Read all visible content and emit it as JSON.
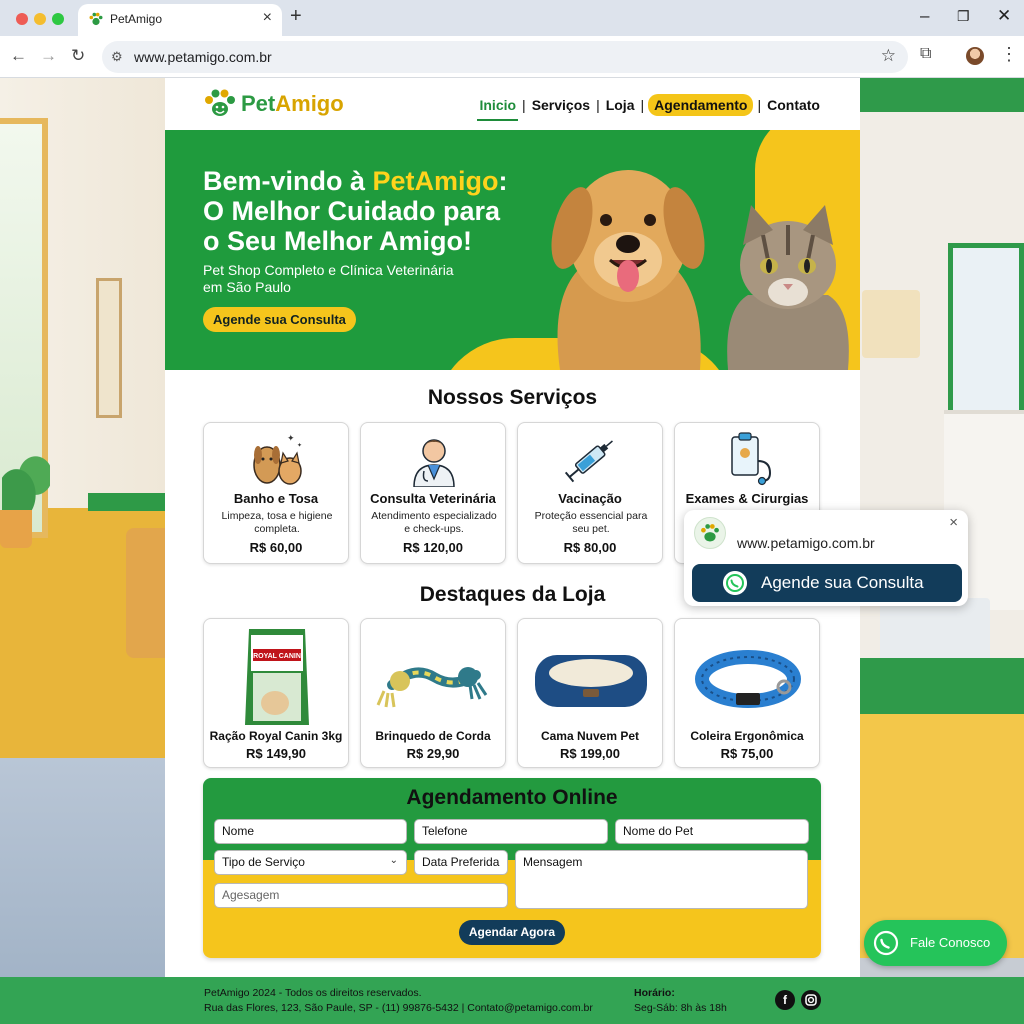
{
  "browser": {
    "tab_title": "PetAmigo",
    "url": "www.petamigo.com.br"
  },
  "site": {
    "logo": {
      "pet": "Pet",
      "amigo": "Amigo"
    },
    "nav": [
      "Inicio",
      "Serviços",
      "Loja",
      "Agendamento",
      "Contato"
    ],
    "nav_separator": "|",
    "hero": {
      "title_line1_prefix": "Bem-vindo à ",
      "title_line1_brand": "PetAmigo",
      "title_line1_suffix": ":",
      "title_line2": "O Melhor Cuidado para",
      "title_line3": "o Seu  Melhor Amigo!",
      "subtitle_line1": "Pet Shop Completo e Clínica Veterinária",
      "subtitle_line2": "em São Paulo",
      "cta": "Agende sua Consulta"
    },
    "services_title": "Nossos Serviços",
    "services": [
      {
        "name": "Banho e Tosa",
        "desc_line1": "Limpeza, tosa e higiene",
        "desc_line2": "completa.",
        "price": "R$ 60,00",
        "icon": "dog-cat-icon"
      },
      {
        "name": "Consulta Veterinária",
        "desc_line1": "Atendimento especializado",
        "desc_line2": "e check-ups.",
        "price": "R$ 120,00",
        "icon": "veterinarian-icon"
      },
      {
        "name": "Vacinação",
        "desc_line1": "Proteção essencial para",
        "desc_line2": "seu pet.",
        "price": "R$ 80,00",
        "icon": "syringe-icon"
      },
      {
        "name": "Exames & Cirurgias",
        "desc_line1": "",
        "desc_line2": "",
        "price": "",
        "icon": "clipboard-stethoscope-icon"
      }
    ],
    "shop_title": "Destaques da Loja",
    "products": [
      {
        "name": "Ração Royal Canin 3kg",
        "price": "R$ 149,90",
        "image_text": "ROYAL CANIN"
      },
      {
        "name": "Brinquedo de Corda",
        "price": "R$ 29,90"
      },
      {
        "name": "Cama Nuvem Pet",
        "price": "R$ 199,00"
      },
      {
        "name": "Coleira Ergonômica",
        "price": "R$ 75,00"
      }
    ],
    "booking": {
      "title": "Agendamento Online",
      "name": "Nome",
      "phone": "Telefone",
      "pet_name": "Nome do Pet",
      "service_type": "Tipo de Serviço",
      "date": "Data Preferida",
      "message": "Mensagem",
      "extra_placeholder": "Agesagem",
      "submit": "Agendar Agora"
    },
    "footer": {
      "line1": "PetAmigo 2024 - Todos os direitos reservados.",
      "line2": "Rua das Flores, 123, São Paule, SP - (11) 99876-5432 | Contato@petamigo.com.br",
      "hours_label": "Horário:",
      "hours_value": "Seg-Sáb: 8h às 18h",
      "facebook": "f"
    }
  },
  "popup": {
    "url": "www.petamigo.com.br",
    "button": "Agende sua Consulta"
  },
  "whatsapp_float": {
    "label": "Fale Conosco"
  },
  "colors": {
    "brand_green": "#1f9b3d",
    "brand_yellow": "#f5c51c",
    "navy": "#123c5a",
    "whatsapp": "#25c45a"
  }
}
